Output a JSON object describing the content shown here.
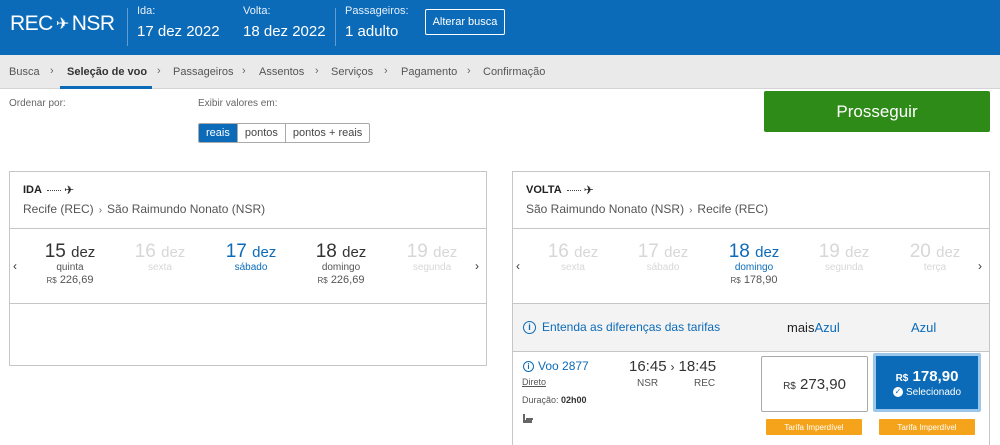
{
  "header": {
    "origin": "REC",
    "destination": "NSR",
    "plane_glyph": "✈",
    "outbound_label": "Ida:",
    "outbound_value": "17 dez 2022",
    "return_label": "Volta:",
    "return_value": "18 dez 2022",
    "passengers_label": "Passageiros:",
    "passengers_value": "1 adulto",
    "change_search": "Alterar busca",
    "brand_color": "#0c6bb8"
  },
  "breadcrumb": {
    "items": [
      "Busca",
      "Seleção de voo",
      "Passageiros",
      "Assentos",
      "Serviços",
      "Pagamento",
      "Confirmação"
    ],
    "active_index": 1,
    "separator": "›"
  },
  "sort": {
    "label": "Ordenar por:"
  },
  "display": {
    "label": "Exibir valores em:",
    "options": [
      "reais",
      "pontos",
      "pontos + reais"
    ],
    "selected_index": 0
  },
  "proceed_button": {
    "label": "Prosseguir",
    "color": "#2f8b17"
  },
  "outbound": {
    "direction": "IDA",
    "route_from": "Recife (REC)",
    "route_to": "São Raimundo Nonato (NSR)",
    "prev_arrow": "‹",
    "next_arrow": "›",
    "days": [
      {
        "day": "15",
        "month": "dez",
        "weekday": "quinta",
        "currency": "R$",
        "price": "226,69",
        "state": "normal"
      },
      {
        "day": "16",
        "month": "dez",
        "weekday": "sexta",
        "currency": "",
        "price": "",
        "state": "disabled"
      },
      {
        "day": "17",
        "month": "dez",
        "weekday": "sábado",
        "currency": "",
        "price": "",
        "state": "selected"
      },
      {
        "day": "18",
        "month": "dez",
        "weekday": "domingo",
        "currency": "R$",
        "price": "226,69",
        "state": "normal"
      },
      {
        "day": "19",
        "month": "dez",
        "weekday": "segunda",
        "currency": "",
        "price": "",
        "state": "disabled"
      }
    ]
  },
  "return": {
    "direction": "VOLTA",
    "route_from": "São Raimundo Nonato (NSR)",
    "route_to": "Recife (REC)",
    "prev_arrow": "‹",
    "next_arrow": "›",
    "days": [
      {
        "day": "16",
        "month": "dez",
        "weekday": "sexta",
        "currency": "",
        "price": "",
        "state": "disabled"
      },
      {
        "day": "17",
        "month": "dez",
        "weekday": "sábado",
        "currency": "",
        "price": "",
        "state": "disabled"
      },
      {
        "day": "18",
        "month": "dez",
        "weekday": "domingo",
        "currency": "R$",
        "price": "178,90",
        "state": "selected"
      },
      {
        "day": "19",
        "month": "dez",
        "weekday": "segunda",
        "currency": "",
        "price": "",
        "state": "disabled"
      },
      {
        "day": "20",
        "month": "dez",
        "weekday": "terça",
        "currency": "",
        "price": "",
        "state": "disabled"
      }
    ],
    "fare_info": "Entenda as diferenças das tarifas",
    "tier_plus_prefix": "mais",
    "tier_plus_brand": "Azul",
    "tier_basic": "Azul",
    "flight": {
      "number": "Voo 2877",
      "type": "Direto",
      "duration_label": "Duração:",
      "duration": "02h00",
      "departure": "16:45",
      "arrival": "18:45",
      "from": "NSR",
      "to": "REC",
      "fares": [
        {
          "currency": "R$",
          "amount": "273,90",
          "selected": false,
          "tag": "Tarifa Imperdível"
        },
        {
          "currency": "R$",
          "amount": "178,90",
          "selected": true,
          "selected_label": "Selecionado",
          "tag": "Tarifa Imperdível"
        }
      ]
    }
  },
  "icons": {
    "info": "info-circle-icon",
    "check": "check-circle-icon",
    "seat": "seat-icon",
    "plane": "plane-icon"
  },
  "tag_color": "#f5a31a"
}
